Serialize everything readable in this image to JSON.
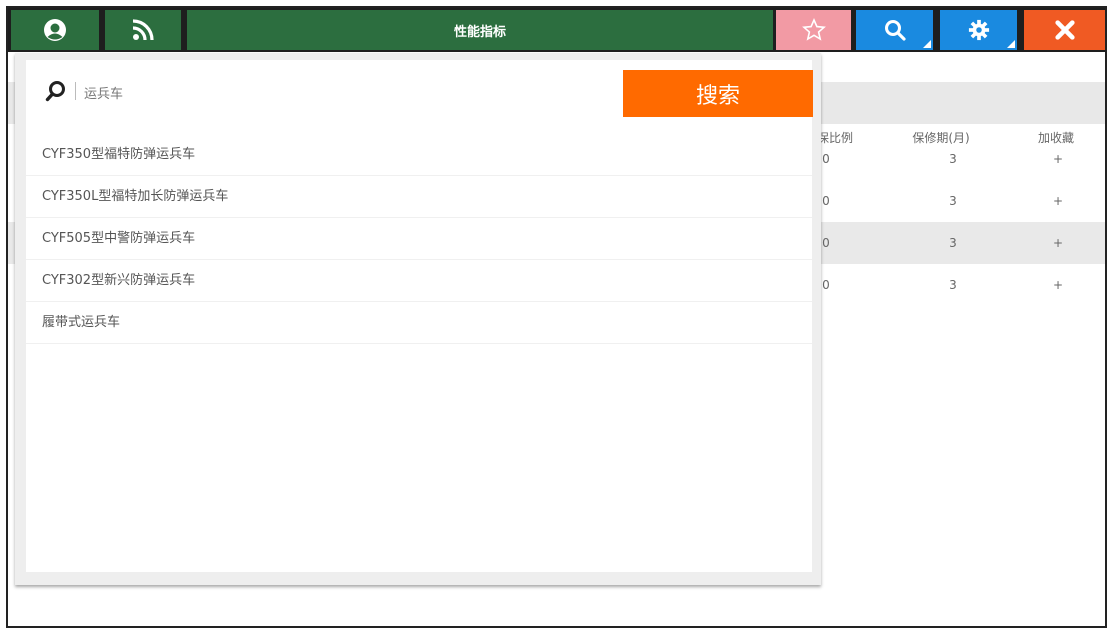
{
  "colors": {
    "green": "#2c6e3f",
    "star_pink": "#f29aa4",
    "blue": "#1a8ae0",
    "close_orange": "#f05a23",
    "search_button": "#ff6a00"
  },
  "header": {
    "title": "性能指标",
    "icons": [
      "user-icon",
      "rss-icon",
      "star-icon",
      "search-icon",
      "gear-icon",
      "close-icon"
    ]
  },
  "table": {
    "columns": [
      "保比例",
      "保修期(月)",
      "加收藏"
    ],
    "rows": [
      {
        "ratio": "0",
        "warranty": "3",
        "add": "+"
      },
      {
        "ratio": "0",
        "warranty": "3",
        "add": "+"
      },
      {
        "ratio": "0",
        "warranty": "3",
        "add": "+"
      },
      {
        "ratio": "0",
        "warranty": "3",
        "add": "+"
      }
    ]
  },
  "search": {
    "value": "运兵车",
    "button_label": "搜索",
    "results": [
      "CYF350型福特防弹运兵车",
      "CYF350L型福特加长防弹运兵车",
      "CYF505型中警防弹运兵车",
      "CYF302型新兴防弹运兵车",
      "履带式运兵车"
    ]
  }
}
